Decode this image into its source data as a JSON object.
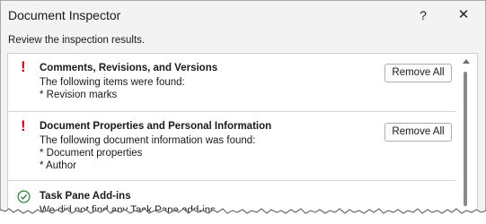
{
  "window": {
    "title": "Document Inspector",
    "help_label": "?",
    "close_label": "✕"
  },
  "instructions": "Review the inspection results.",
  "sections": [
    {
      "status": "warning",
      "status_glyph": "!",
      "title": "Comments, Revisions, and Versions",
      "lines": [
        "The following items were found:",
        "* Revision marks"
      ],
      "button_label": "Remove All"
    },
    {
      "status": "warning",
      "status_glyph": "!",
      "title": "Document Properties and Personal Information",
      "lines": [
        "The following document information was found:",
        "* Document properties",
        "* Author"
      ],
      "button_label": "Remove All"
    },
    {
      "status": "ok",
      "title": "Task Pane Add-ins",
      "lines": [
        "We did not find any Task Pane add-ins."
      ]
    }
  ],
  "colors": {
    "warning": "#d0021b",
    "ok": "#2e7d32"
  }
}
